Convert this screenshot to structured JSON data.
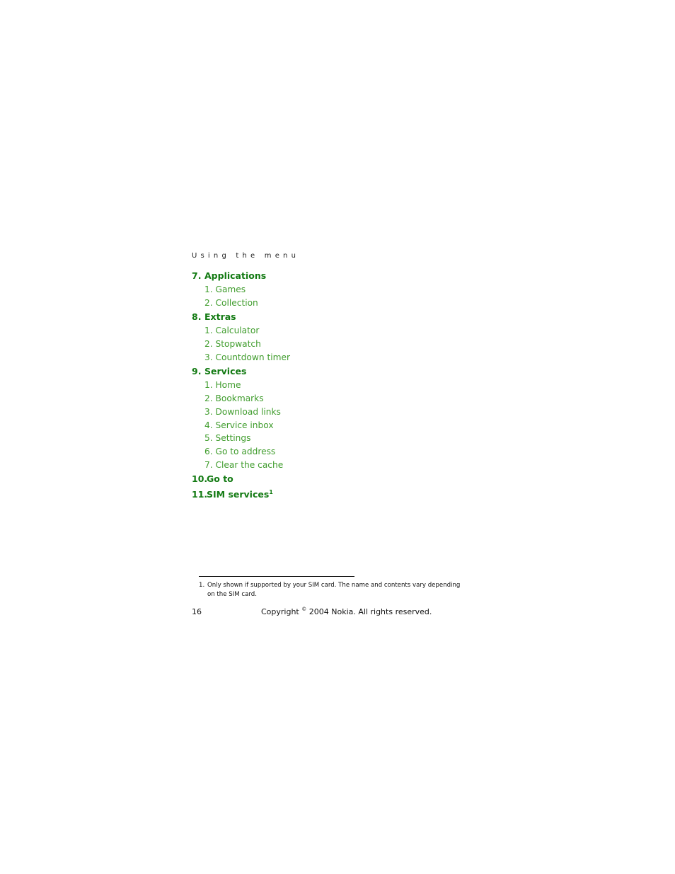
{
  "header": {
    "section_title": "Using the menu"
  },
  "menu": [
    {
      "number": "7.",
      "label": "Applications",
      "subitems": [
        "1. Games",
        "2. Collection"
      ]
    },
    {
      "number": "8.",
      "label": "Extras",
      "subitems": [
        "1. Calculator",
        "2. Stopwatch",
        "3. Countdown timer"
      ]
    },
    {
      "number": "9.",
      "label": "Services",
      "subitems": [
        "1. Home",
        "2. Bookmarks",
        "3. Download links",
        "4. Service inbox",
        "5. Settings",
        "6. Go to address",
        "7. Clear the cache"
      ]
    },
    {
      "number": "10.",
      "label": "Go to",
      "subitems": []
    },
    {
      "number": "11.",
      "label": "SIM services",
      "footnote_ref": "1",
      "subitems": []
    }
  ],
  "footnote": {
    "number": "1.",
    "line1": "Only shown if supported by your SIM card. The name and contents vary depending",
    "line2": "on the SIM card."
  },
  "footer": {
    "page_number": "16",
    "copyright_prefix": "Copyright",
    "copyright_symbol": "©",
    "copyright_suffix": "2004 Nokia. All rights reserved."
  },
  "colors": {
    "top_level": "#127a12",
    "sub_level": "#3f9c2c"
  }
}
